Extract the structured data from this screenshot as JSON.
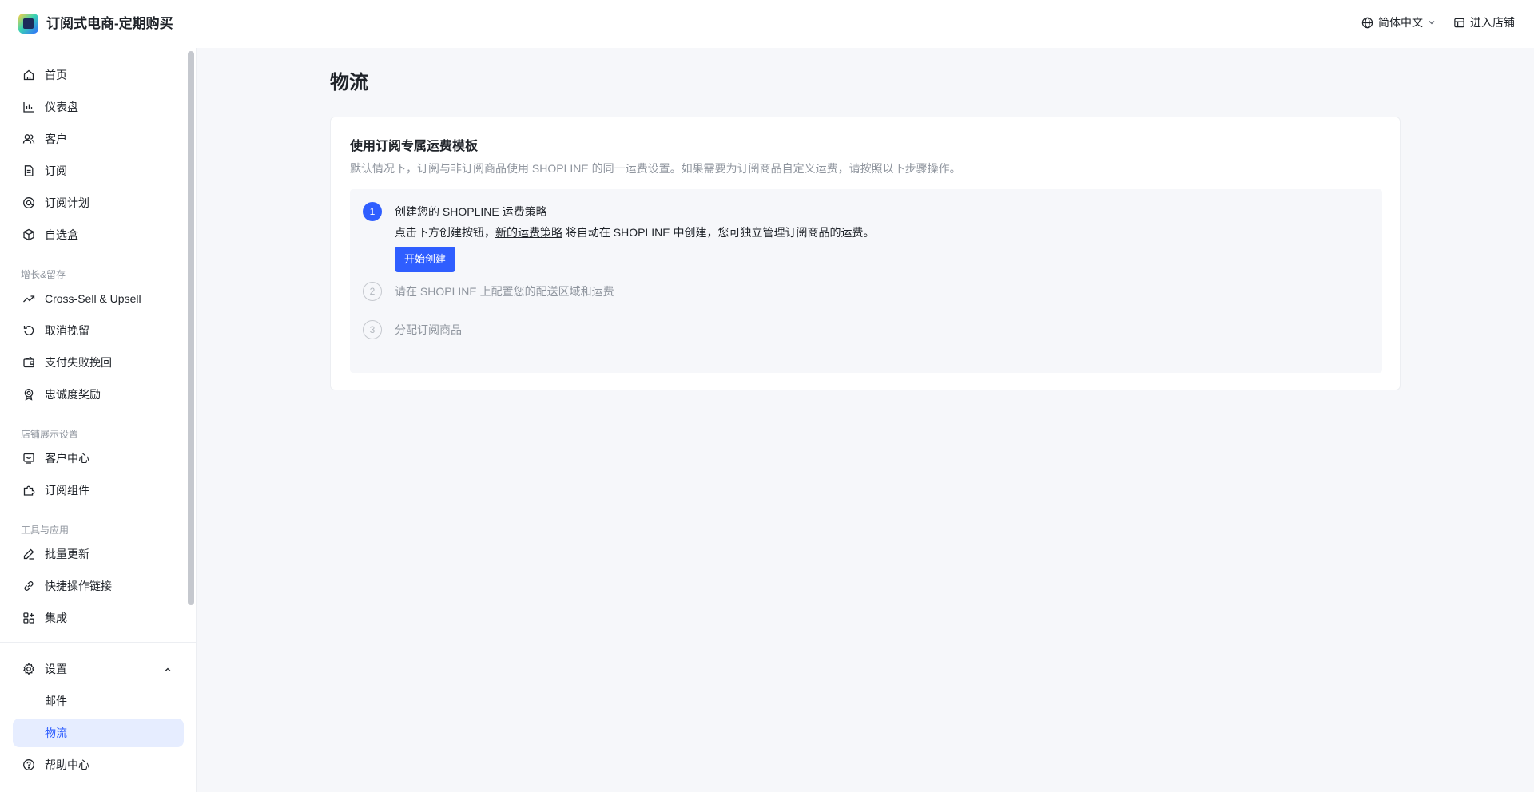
{
  "header": {
    "app_title": "订阅式电商-定期购买",
    "language": "简体中文",
    "enter_store": "进入店铺"
  },
  "sidebar": {
    "items": [
      {
        "label": "首页",
        "icon": "home-icon"
      },
      {
        "label": "仪表盘",
        "icon": "bar-chart-icon"
      },
      {
        "label": "客户",
        "icon": "users-icon"
      },
      {
        "label": "订阅",
        "icon": "document-icon"
      },
      {
        "label": "订阅计划",
        "icon": "plan-icon"
      },
      {
        "label": "自选盒",
        "icon": "box-icon"
      }
    ],
    "section_growth": "增长&留存",
    "growth_items": [
      {
        "label": "Cross-Sell & Upsell",
        "icon": "trend-up-icon"
      },
      {
        "label": "取消挽留",
        "icon": "undo-icon"
      },
      {
        "label": "支付失败挽回",
        "icon": "wallet-icon"
      },
      {
        "label": "忠诚度奖励",
        "icon": "medal-icon"
      }
    ],
    "section_store": "店铺展示设置",
    "store_items": [
      {
        "label": "客户中心",
        "icon": "customer-center-icon"
      },
      {
        "label": "订阅组件",
        "icon": "puzzle-icon"
      }
    ],
    "section_tools": "工具与应用",
    "tool_items": [
      {
        "label": "批量更新",
        "icon": "edit-icon"
      },
      {
        "label": "快捷操作链接",
        "icon": "link-icon"
      },
      {
        "label": "集成",
        "icon": "apps-icon"
      }
    ],
    "settings": {
      "label": "设置",
      "icon": "gear-icon"
    },
    "settings_children": [
      {
        "label": "邮件"
      },
      {
        "label": "物流"
      }
    ],
    "help": {
      "label": "帮助中心",
      "icon": "help-icon"
    }
  },
  "main": {
    "page_title": "物流",
    "card": {
      "title": "使用订阅专属运费模板",
      "description": "默认情况下，订阅与非订阅商品使用 SHOPLINE 的同一运费设置。如果需要为订阅商品自定义运费，请按照以下步骤操作。",
      "steps": [
        {
          "number": "1",
          "title": "创建您的 SHOPLINE 运费策略",
          "desc_before": "点击下方创建按钮，",
          "desc_link": "新的运费策略",
          "desc_after": " 将自动在 SHOPLINE 中创建，您可独立管理订阅商品的运费。",
          "button": "开始创建"
        },
        {
          "number": "2",
          "title": "请在 SHOPLINE 上配置您的配送区域和运费"
        },
        {
          "number": "3",
          "title": "分配订阅商品"
        }
      ]
    }
  },
  "colors": {
    "accent": "#2f5eff",
    "active_bg": "#e6edff",
    "muted_text": "#8f959e"
  }
}
